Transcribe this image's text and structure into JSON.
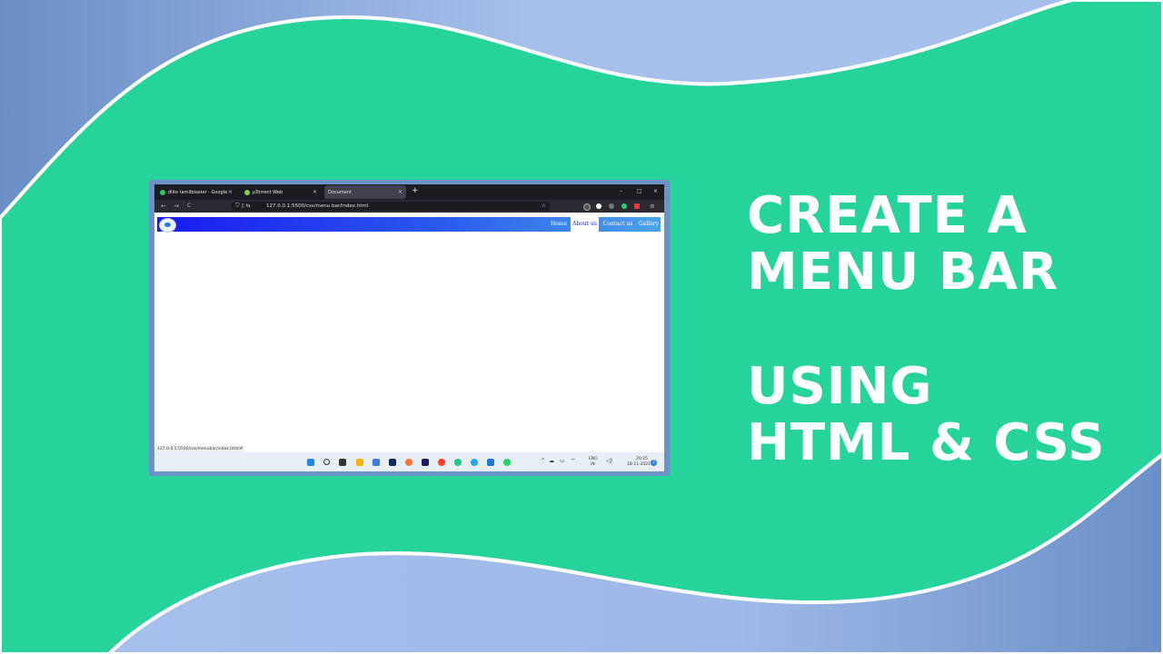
{
  "headline": {
    "line1": "CREATE A",
    "line2": "MENU BAR",
    "line3": "USING",
    "line4": "HTML & CSS"
  },
  "colors": {
    "background_green": "#26d39b",
    "wave_blue": "#9fb9e8",
    "wave_dark": "#6e93c8",
    "frame_border": "#6c93c8",
    "nav_gradient_start": "#1a1af0",
    "nav_gradient_end": "#4aa3ea"
  },
  "browser": {
    "tabs": [
      {
        "label": "dlite tamilblaster - Google Sear",
        "icon": "google-icon",
        "close": "×"
      },
      {
        "label": "µTorrent Web",
        "icon": "utorrent-icon",
        "close": "×"
      },
      {
        "label": "Document",
        "icon": "",
        "close": "×"
      }
    ],
    "new_tab": "+",
    "window_controls": {
      "minimize": "–",
      "maximize": "□",
      "close": "×"
    },
    "toolbar": {
      "back": "←",
      "forward": "→",
      "reload": "C"
    },
    "url": "127.0.0.1:5500/css/menu bar/index.html",
    "status_url": "127.0.0.1:5500/css/menubar/index.html#"
  },
  "page": {
    "menu": [
      {
        "label": "Home"
      },
      {
        "label": "About us",
        "active": true
      },
      {
        "label": "Contact us"
      },
      {
        "label": "Gallery"
      }
    ]
  },
  "taskbar": {
    "language": "ENG",
    "region": "IN",
    "time": "20:25",
    "date": "18-11-2021",
    "notifications": "2"
  }
}
